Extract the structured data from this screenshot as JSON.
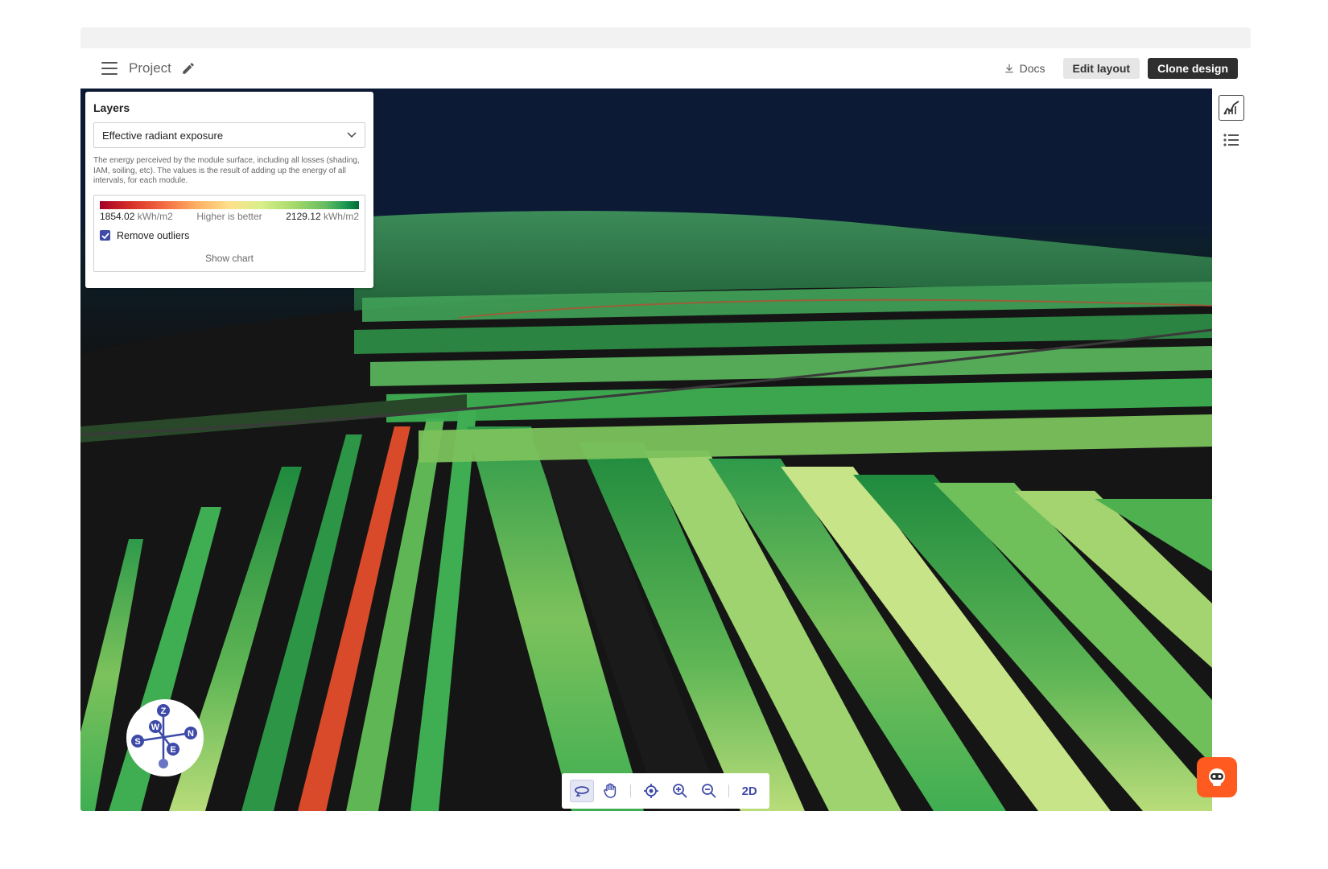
{
  "header": {
    "project_title": "Project",
    "docs_label": "Docs",
    "edit_layout_label": "Edit layout",
    "clone_design_label": "Clone design"
  },
  "layers_panel": {
    "title": "Layers",
    "selected_layer": "Effective radiant exposure",
    "description": "The energy perceived by the module surface, including all losses (shading, IAM, soiling, etc). The values is the result of adding up the energy of all intervals, for each module.",
    "legend": {
      "min_value": "1854.02",
      "max_value": "2129.12",
      "unit": "kWh/m2",
      "hint": "Higher is better",
      "colors": [
        "#a50026",
        "#d73027",
        "#f46d43",
        "#fdae61",
        "#fee08b",
        "#d9ef8b",
        "#a6d96a",
        "#66bd63",
        "#1a9850",
        "#006837"
      ]
    },
    "remove_outliers_label": "Remove outliers",
    "remove_outliers_checked": true,
    "show_chart_label": "Show chart"
  },
  "compass": {
    "labels": [
      "Z",
      "W",
      "N",
      "S",
      "E"
    ]
  },
  "toolbar": {
    "tools": [
      "orbit-icon",
      "pan-hand-icon",
      "target-icon",
      "zoom-in-icon",
      "zoom-out-icon"
    ],
    "view_mode_label": "2D"
  },
  "right_rail": {
    "buttons": [
      "chart-icon",
      "list-icon"
    ]
  },
  "colors": {
    "accent": "#3e4aa8",
    "chat": "#ff5a1f",
    "dark_button": "#2f2f2f"
  }
}
